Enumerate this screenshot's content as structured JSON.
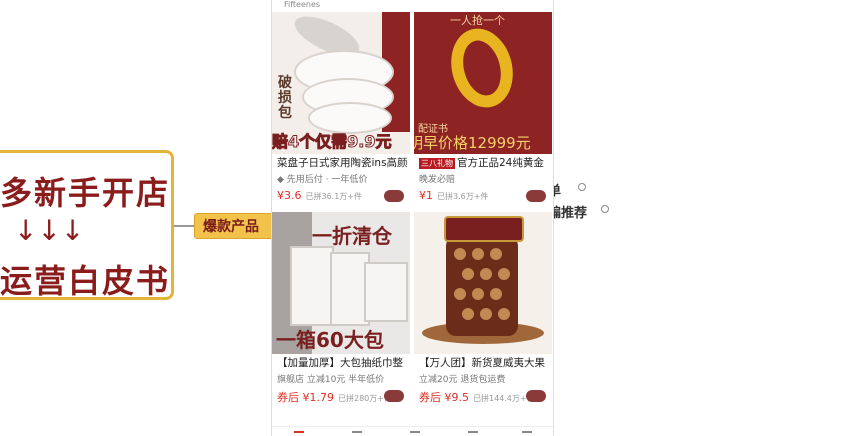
{
  "mindmap": {
    "root_line1": "多新手开店",
    "root_arrows": "↓↓↓",
    "root_line2": "运营白皮书",
    "child": "爆款产品",
    "right_item1": "单",
    "right_item2": "编推荐"
  },
  "phone": {
    "top_strip": "Fifteenes",
    "products": [
      {
        "img_text_lines": [
          "破",
          "损",
          "包",
          "赔"
        ],
        "img_banner": "4个仅需9.9元",
        "title": "菜盘子日式家用陶瓷ins高颜",
        "subtitle": "◆ 先用后付 · 一年低价",
        "price": "¥3.6",
        "sold": "已拼36.1万+件"
      },
      {
        "img_top": "一人抢一个",
        "img_small": "配证书",
        "img_banner": "明早价格12999元",
        "tag": "三八礼物",
        "title": "官方正品24纯黄金",
        "subtitle": "晚发必赔",
        "price": "¥1",
        "sold": "已拼3.6万+件"
      },
      {
        "img_title": "一折清仓",
        "img_banner": "一箱60大包",
        "title": "【加量加厚】大包抽纸巾整",
        "subtitle": "旗舰店 立减10元 半年低价",
        "price": "券后 ¥1.79",
        "sold": "已拼280万+件"
      },
      {
        "title": "【万人团】新货夏威夷大果",
        "subtitle": "立减20元 退货包运费",
        "price": "券后 ¥9.5",
        "sold": "已拼144.4万+件"
      }
    ]
  },
  "colors": {
    "accent_red": "#8e2323",
    "price_red": "#e02e24",
    "mindmap_border": "#e4b43a",
    "mindmap_child_bg": "#f2c24b"
  }
}
